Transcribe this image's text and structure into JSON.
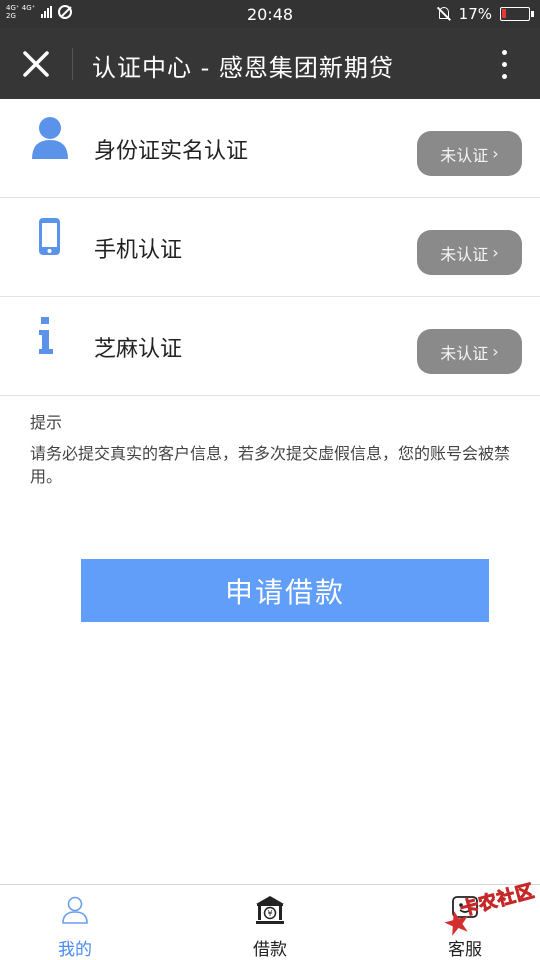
{
  "status_bar": {
    "network_top": "4G⁺ 4G⁺",
    "network_bottom": "2G",
    "time": "20:48",
    "battery_percent": "17%",
    "battery_level": 0.17
  },
  "header": {
    "title": "认证中心 - 感恩集团新期贷"
  },
  "verifications": [
    {
      "label": "身份证实名认证",
      "status": "未认证",
      "icon": "person-icon"
    },
    {
      "label": "手机认证",
      "status": "未认证",
      "icon": "phone-icon"
    },
    {
      "label": "芝麻认证",
      "status": "未认证",
      "icon": "info-icon"
    }
  ],
  "tip": {
    "title": "提示",
    "text": "请务必提交真实的客户信息，若多次提交虚假信息，您的账号会被禁用。"
  },
  "apply_button": "申请借款",
  "bottom_nav": [
    {
      "label": "我的",
      "icon": "user-icon",
      "active": true
    },
    {
      "label": "借款",
      "icon": "bank-icon",
      "active": false
    },
    {
      "label": "客服",
      "icon": "service-icon",
      "active": false
    }
  ],
  "watermark": "卡农社区",
  "colors": {
    "accent": "#609ef9",
    "icon_blue": "#5b93ea",
    "header_bg": "#363636",
    "status_button": "#8a8a8a"
  }
}
